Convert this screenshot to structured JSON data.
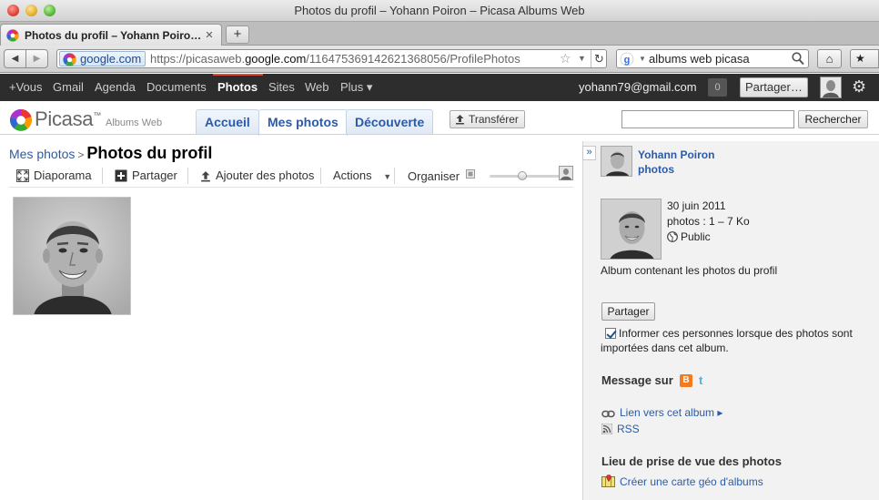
{
  "window": {
    "title": "Photos du profil – Yohann Poiron – Picasa Albums Web"
  },
  "tabs": [
    {
      "label": "Photos du profil – Yohann Poiro…",
      "close": "✕"
    }
  ],
  "newtab": "+",
  "nav": {
    "back": "◀",
    "forward": "▶",
    "site_id": "google.com",
    "url_prefix": "https://picasaweb.",
    "url_domain": "google.com",
    "url_path": "/116475369142621368056/ProfilePhotos",
    "search_query": "albums web picasa",
    "reload": "↻",
    "star": "☆",
    "home": "⌂",
    "bookmarks": "★"
  },
  "gbar": {
    "links": [
      "+Vous",
      "Gmail",
      "Agenda",
      "Documents",
      "Photos",
      "Sites",
      "Web",
      "Plus ▾"
    ],
    "active": "Photos",
    "email": "yohann79@gmail.com",
    "notifications": "0",
    "share": "Partager…",
    "gear": "⚙"
  },
  "header": {
    "logo_word": "Picasa",
    "logo_tm": "™",
    "logo_sub": "Albums Web",
    "tabs": [
      "Accueil",
      "Mes photos",
      "Découverte"
    ],
    "active_tab": "Mes photos",
    "upload": "Transférer",
    "search_value": "",
    "search_button": "Rechercher"
  },
  "main": {
    "breadcrumb_link": "Mes photos",
    "breadcrumb_sep": ">",
    "title": "Photos du profil",
    "toolbar": {
      "slideshow": "Diaporama",
      "share": "Partager",
      "add_photos": "Ajouter des photos",
      "actions": "Actions",
      "organize": "Organiser"
    },
    "zoom_level": 0.45
  },
  "sidebar": {
    "collapse": "»",
    "owner_name": "Yohann Poiron",
    "owner_sub": "photos",
    "album_date": "30 juin 2011",
    "album_info": "photos : 1 – 7 Ko",
    "album_visibility": "Public",
    "album_desc": "Album contenant les photos du profil",
    "share_button": "Partager",
    "notify_text": "Informer ces personnes lorsque des photos sont importées dans cet album.",
    "notify_checked": true,
    "message_title": "Message sur",
    "blogger_glyph": "B",
    "twitter_glyph": "t",
    "link_album": "Lien vers cet album ▸",
    "rss": "RSS",
    "location_title": "Lieu de prise de vue des photos",
    "map_link": "Créer une carte géo d'albums"
  },
  "colors": {
    "link": "#2b5ba8",
    "gbar": "#2d2d2d",
    "gbar_accent": "#dd4b39",
    "sidebar_bg": "#f2f2f2"
  }
}
